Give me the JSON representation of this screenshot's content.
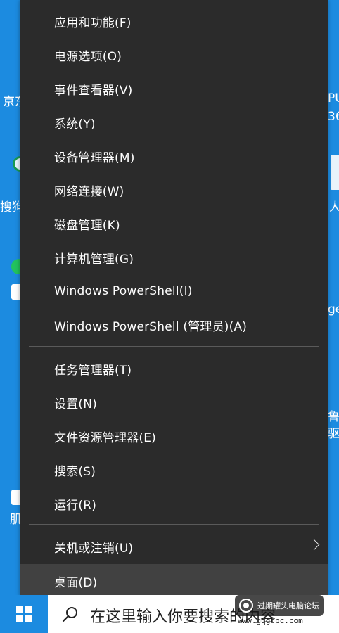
{
  "menu": {
    "items": [
      {
        "label": "应用和功能(F)"
      },
      {
        "label": "电源选项(O)"
      },
      {
        "label": "事件查看器(V)"
      },
      {
        "label": "系统(Y)"
      },
      {
        "label": "设备管理器(M)"
      },
      {
        "label": "网络连接(W)"
      },
      {
        "label": "磁盘管理(K)"
      },
      {
        "label": "计算机管理(G)"
      },
      {
        "label": "Windows PowerShell(I)"
      },
      {
        "label": "Windows PowerShell (管理员)(A)"
      },
      {
        "label": "任务管理器(T)"
      },
      {
        "label": "设置(N)"
      },
      {
        "label": "文件资源管理器(E)"
      },
      {
        "label": "搜索(S)"
      },
      {
        "label": "运行(R)"
      },
      {
        "label": "关机或注销(U)"
      },
      {
        "label": "桌面(D)"
      }
    ]
  },
  "desktop_peek": {
    "left_1": "京东",
    "left_2": "搜狗",
    "left_3": "肌",
    "right_1": "PU",
    "right_2": "36",
    "right_3": "人",
    "right_4": "ge",
    "right_5": "鲁大",
    "right_6": "驱炉"
  },
  "taskbar": {
    "search_text": "在这里输入你要搜索的内容"
  },
  "watermark": {
    "text": "过期罐头电脑论坛",
    "url": "www.gqgtpc.com"
  },
  "colors": {
    "menu_bg": "#2b2b2b",
    "hover_bg": "#414141",
    "desktop": "#1c8be0",
    "taskbar": "#dadada"
  }
}
